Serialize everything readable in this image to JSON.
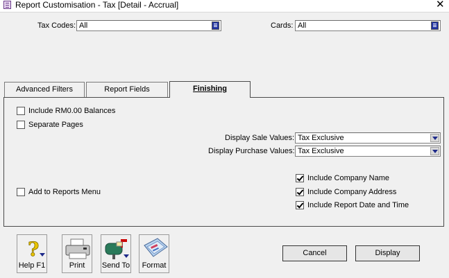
{
  "window": {
    "title": "Report Customisation - Tax [Detail - Accrual]",
    "close": "✕"
  },
  "filters": {
    "tax_codes_label": "Tax Codes:",
    "tax_codes_value": "All",
    "cards_label": "Cards:",
    "cards_value": "All"
  },
  "tabs": [
    {
      "label": "Advanced Filters"
    },
    {
      "label": "Report Fields"
    },
    {
      "label": "Finishing",
      "active": true
    }
  ],
  "finishing": {
    "include_zero_balances": {
      "label": "Include RM0.00 Balances",
      "checked": false
    },
    "separate_pages": {
      "label": "Separate Pages",
      "checked": false
    },
    "display_sale_values": {
      "label": "Display Sale Values:",
      "value": "Tax Exclusive"
    },
    "display_purchase_values": {
      "label": "Display Purchase Values:",
      "value": "Tax Exclusive"
    },
    "add_to_reports_menu": {
      "label": "Add to Reports Menu",
      "checked": false
    },
    "include_company_name": {
      "label": "Include Company Name",
      "checked": true
    },
    "include_company_address": {
      "label": "Include Company Address",
      "checked": true
    },
    "include_report_date_time": {
      "label": "Include Report Date and Time",
      "checked": true
    }
  },
  "toolbar": {
    "help": "Help F1",
    "print": "Print",
    "send_to": "Send To",
    "format": "Format"
  },
  "buttons": {
    "cancel": "Cancel",
    "display": "Display"
  }
}
